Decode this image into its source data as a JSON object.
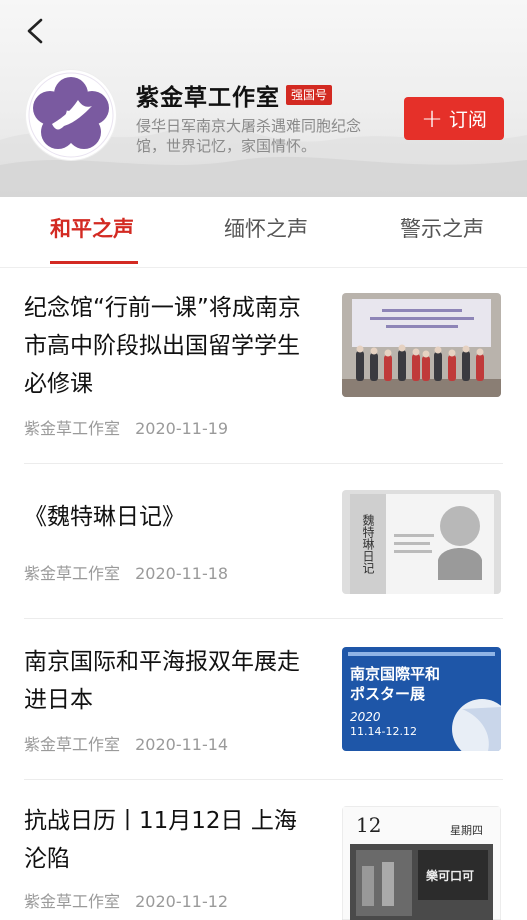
{
  "header": {
    "back_icon": "chevron-left-icon",
    "title": "紫金草工作室",
    "badge": "强国号",
    "subtitle": "侵华日军南京大屠杀遇难同胞纪念馆，世界记忆，家国情怀。",
    "subscribe_label": "订阅",
    "subscribe_color": "#e53029"
  },
  "tabs": [
    {
      "label": "和平之声",
      "active": true
    },
    {
      "label": "缅怀之声",
      "active": false
    },
    {
      "label": "警示之声",
      "active": false
    }
  ],
  "accent_color": "#d32a22",
  "articles": [
    {
      "title": "纪念馆“行前一课”将成南京市高中阶段拟出国留学学生必修课",
      "source": "紫金草工作室",
      "date": "2020-11-19"
    },
    {
      "title": "《魏特琳日记》",
      "source": "紫金草工作室",
      "date": "2020-11-18",
      "thumb": {
        "book_title": "魏特琳日记"
      }
    },
    {
      "title": " 南京国际和平海报双年展走进日本",
      "source": "紫金草工作室",
      "date": "2020-11-14",
      "thumb": {
        "line1": "南京国際平和",
        "line2": "ポスター展",
        "year": "2020",
        "dates": "11.14-12.12"
      }
    },
    {
      "title": "抗战日历丨11月12日 上海沦陷",
      "source": "紫金草工作室",
      "date": "2020-11-12",
      "thumb": {
        "day": "12",
        "weekday": "星期四",
        "ad": "樂可口可"
      }
    }
  ]
}
